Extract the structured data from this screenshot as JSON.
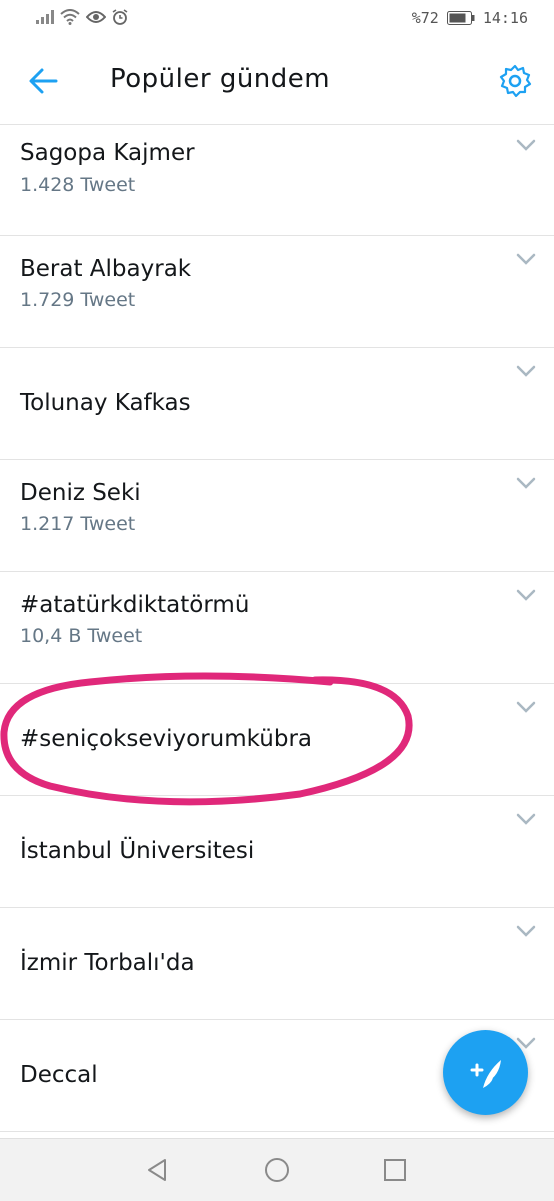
{
  "status_bar": {
    "battery_percent": "%72",
    "time": "14:16",
    "icons": [
      "signal-icon",
      "wifi-icon",
      "eye-icon",
      "alarm-icon",
      "battery-icon"
    ]
  },
  "header": {
    "title": "Popüler gündem",
    "back_icon": "arrow-left-icon",
    "settings_icon": "gear-icon"
  },
  "trends": [
    {
      "name": "Sagopa Kajmer",
      "count": "1.428 Tweet"
    },
    {
      "name": "Berat Albayrak",
      "count": "1.729 Tweet"
    },
    {
      "name": "Tolunay Kafkas",
      "count": ""
    },
    {
      "name": "Deniz Seki",
      "count": "1.217 Tweet"
    },
    {
      "name": "#atatürkdiktatörmü",
      "count": "10,4 B Tweet"
    },
    {
      "name": "#seniçokseviyorumkübra",
      "count": ""
    },
    {
      "name": "İstanbul Üniversitesi",
      "count": ""
    },
    {
      "name": "İzmir Torbalı'da",
      "count": ""
    },
    {
      "name": "Deccal",
      "count": ""
    }
  ],
  "fab": {
    "icon": "compose-tweet-icon"
  },
  "nav": {
    "icons": [
      "back-triangle-icon",
      "home-circle-icon",
      "recents-square-icon"
    ]
  },
  "colors": {
    "accent": "#1da1f2",
    "highlight": "#e0287a",
    "secondary_text": "#657786"
  }
}
